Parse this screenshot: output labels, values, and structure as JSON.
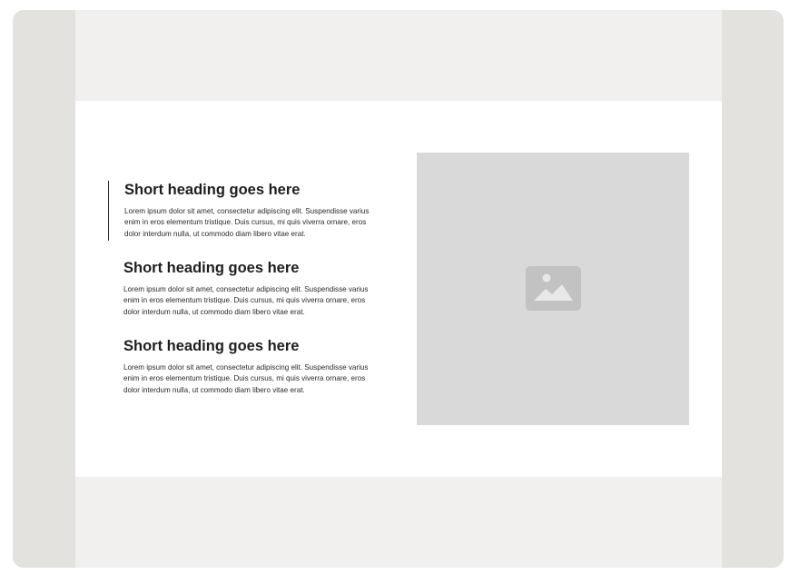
{
  "features": [
    {
      "heading": "Short heading goes here",
      "body": "Lorem ipsum dolor sit amet, consectetur adipiscing elit. Suspendisse varius enim in eros elementum tristique. Duis cursus, mi quis viverra ornare, eros dolor interdum nulla, ut commodo diam libero vitae erat.",
      "active": true
    },
    {
      "heading": "Short heading goes here",
      "body": "Lorem ipsum dolor sit amet, consectetur adipiscing elit. Suspendisse varius enim in eros elementum tristique. Duis cursus, mi quis viverra ornare, eros dolor interdum nulla, ut commodo diam libero vitae erat.",
      "active": false
    },
    {
      "heading": "Short heading goes here",
      "body": "Lorem ipsum dolor sit amet, consectetur adipiscing elit. Suspendisse varius enim in eros elementum tristique. Duis cursus, mi quis viverra ornare, eros dolor interdum nulla, ut commodo diam libero vitae erat.",
      "active": false
    }
  ],
  "image": {
    "icon": "image-placeholder-icon"
  },
  "colors": {
    "frame": "#e3e2df",
    "page": "#f1f0ee",
    "section": "#ffffff",
    "placeholder": "#d9d9d9",
    "placeholder_icon": "#c2c2c2",
    "active_indicator": "#2b2b2b"
  }
}
